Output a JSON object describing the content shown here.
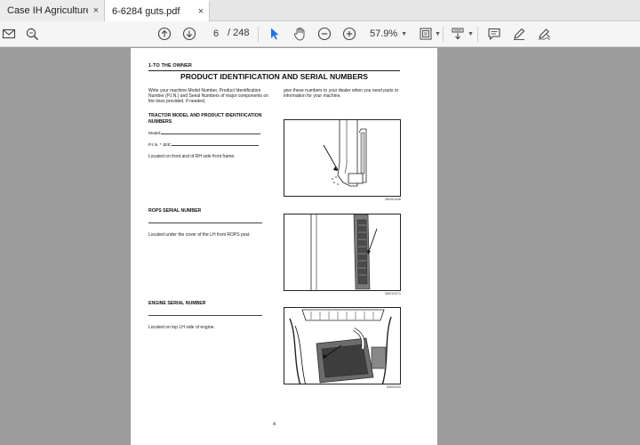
{
  "tabs": [
    {
      "label": "Case IH Agriculture...",
      "close": "×"
    },
    {
      "label": "6-6284 guts.pdf",
      "close": "×"
    }
  ],
  "toolbar": {
    "page_current": "6",
    "page_total": "/ 248",
    "zoom": "57.9%",
    "icons": [
      "mail-icon",
      "search-icon",
      "prev-page-icon",
      "next-page-icon",
      "select-cursor-icon",
      "hand-icon",
      "zoom-out-icon",
      "zoom-in-icon",
      "fit-page-icon",
      "scroll-mode-icon",
      "comment-icon",
      "highlight-icon",
      "sign-icon"
    ]
  },
  "document": {
    "section_header": "1-TO THE OWNER",
    "title": "PRODUCT IDENTIFICATION AND SERIAL NUMBERS",
    "intro_left": "Write your machine Model Number, Product Identification Number (P.I.N.) and Serial Numbers of major components on the lines provided. If needed,",
    "intro_right": "give these numbers to your dealer when you need parts or information for your machine.",
    "tractor": {
      "heading": "TRACTOR MODEL AND PRODUCT IDENTIFICATION NUMBERS",
      "model_label": "Model:",
      "pin_label": "P.I.N. * JEE:",
      "location": "Located on front and of RH side front frame.",
      "fig_code": "SM20/1046"
    },
    "rops": {
      "heading": "ROPS SERIAL NUMBER",
      "location": "Located under the cover of the LH front ROPS post.",
      "fig_code": "SM01/0271"
    },
    "engine": {
      "heading": "ENGINE SERIAL NUMBER",
      "location": "Located on top LH side of engine.",
      "fig_code": "SM03/200"
    },
    "page_number": "4"
  }
}
